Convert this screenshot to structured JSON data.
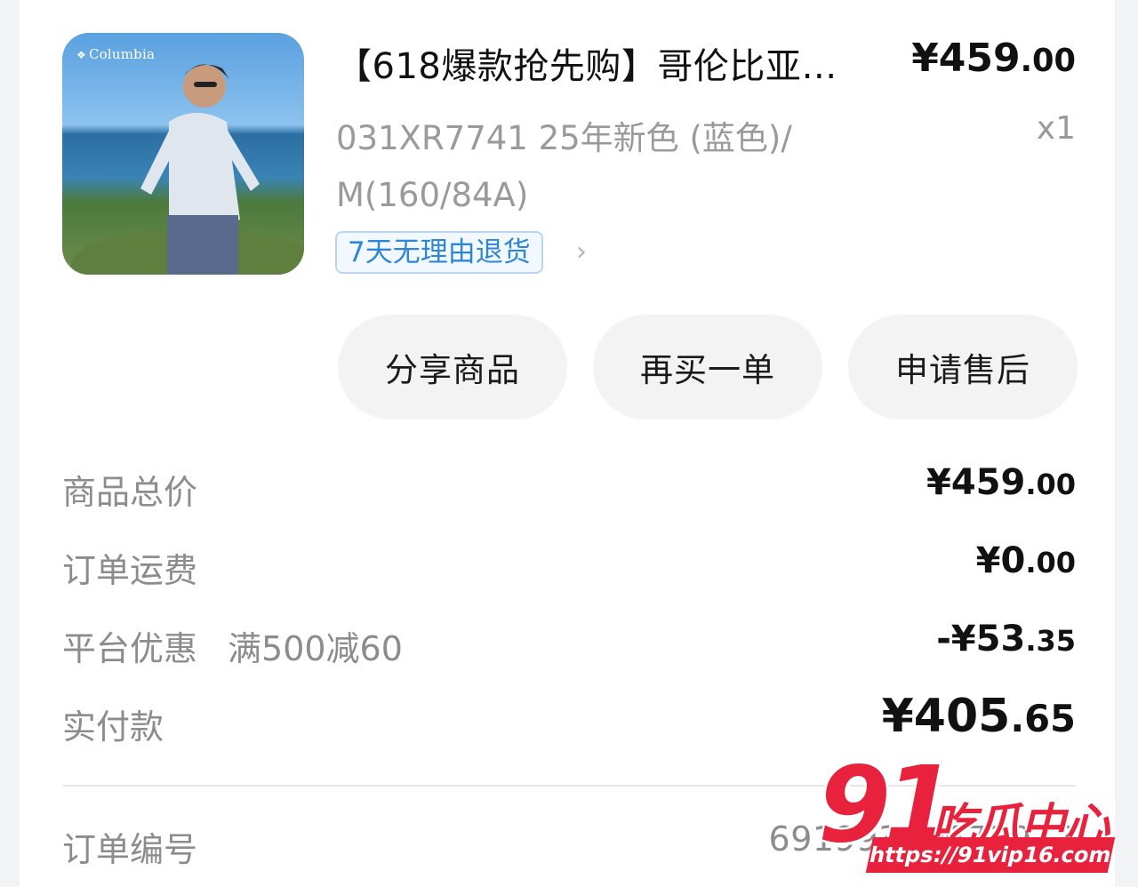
{
  "product": {
    "brand_logo": "Columbia",
    "title": "【618爆款抢先购】哥伦比亚…",
    "price_int": "¥459",
    "price_dec": ".00",
    "spec": "031XR7741 25年新色 (蓝色)/ M(160/84A)",
    "qty": "x1",
    "return_tag": "7天无理由退货",
    "chevron_icon": "chevron-right-icon"
  },
  "actions": {
    "share": "分享商品",
    "rebuy": "再买一单",
    "aftersale": "申请售后"
  },
  "summary": {
    "goods_total_label": "商品总价",
    "goods_total_int": "¥459",
    "goods_total_dec": ".00",
    "shipping_label": "订单运费",
    "shipping_int": "¥0",
    "shipping_dec": ".00",
    "discount_label": "平台优惠",
    "discount_note": "满500减60",
    "discount_int": "-¥53",
    "discount_dec": ".35",
    "paid_label": "实付款",
    "paid_int": "¥405",
    "paid_dec": ".65"
  },
  "order": {
    "number_label": "订单编号",
    "number_value": "69199341672917"
  },
  "watermark": {
    "number": "91",
    "text": "吃瓜中心",
    "url": "https://91vip16.com"
  },
  "colors": {
    "tag_blue": "#2f86d4",
    "watermark_red": "#e8223d"
  }
}
